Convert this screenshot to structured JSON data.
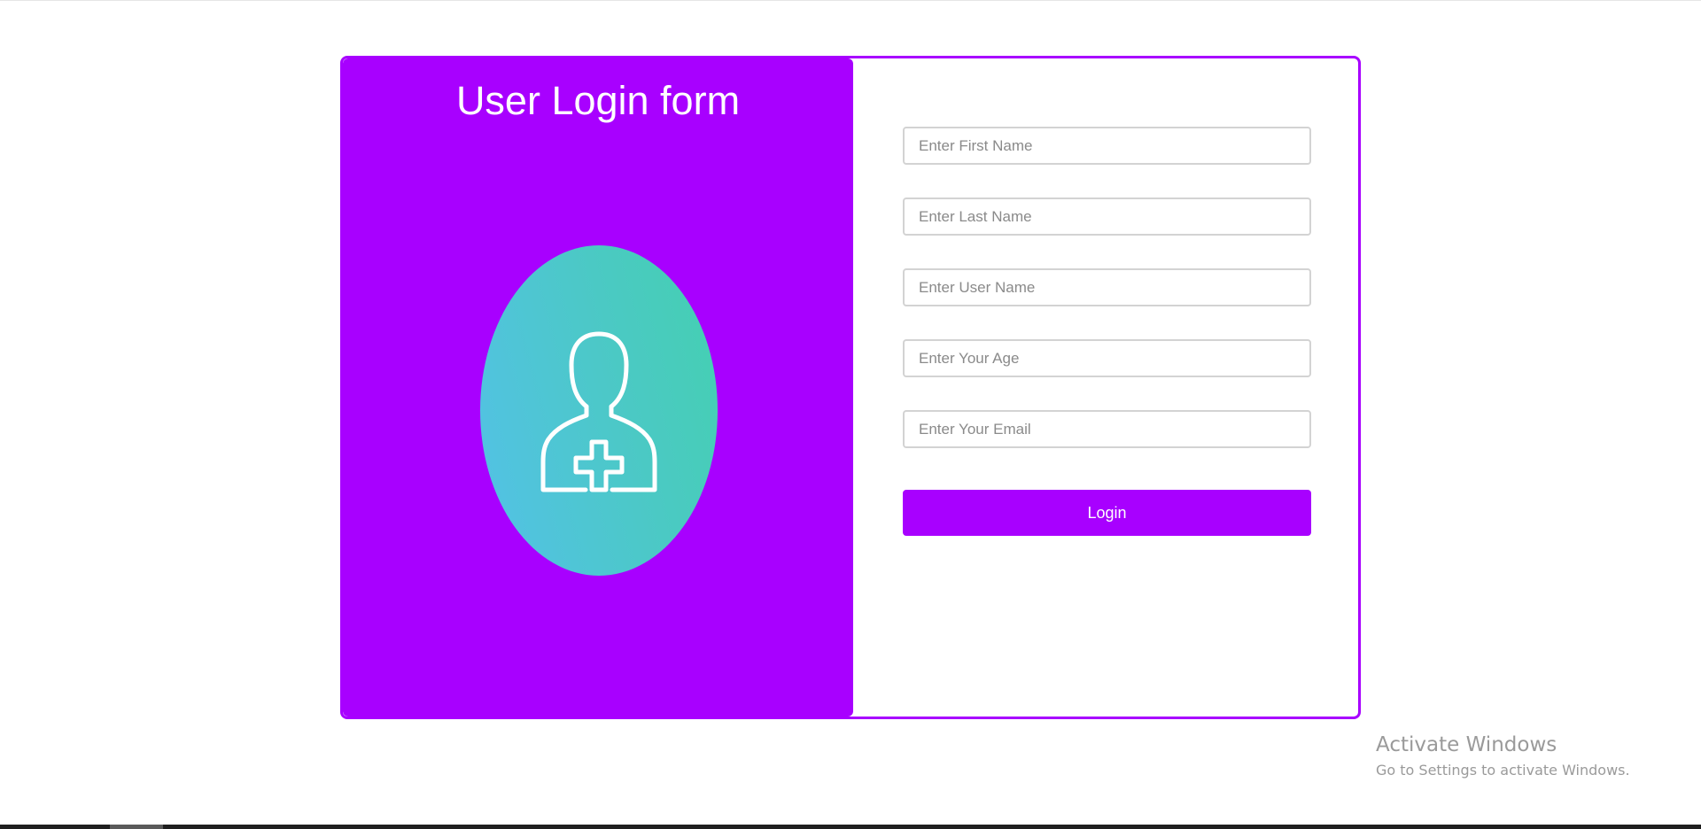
{
  "form": {
    "title": "User Login form",
    "fields": [
      {
        "placeholder": "Enter First Name",
        "value": ""
      },
      {
        "placeholder": "Enter Last Name",
        "value": ""
      },
      {
        "placeholder": "Enter User Name",
        "value": ""
      },
      {
        "placeholder": "Enter Your Age",
        "value": ""
      },
      {
        "placeholder": "Enter Your Email",
        "value": ""
      }
    ],
    "login_label": "Login",
    "avatar_icon": "user-add-icon"
  },
  "watermark": {
    "title": "Activate Windows",
    "subtitle": "Go to Settings to activate Windows."
  },
  "colors": {
    "accent": "#a800ff",
    "avatar_gradient_start": "#53c1e8",
    "avatar_gradient_end": "#44d0b0"
  }
}
